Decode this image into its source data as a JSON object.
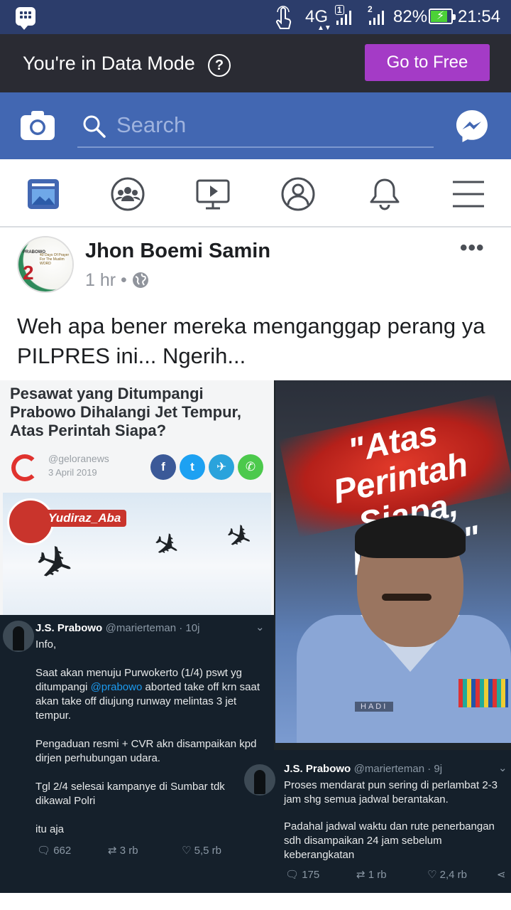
{
  "status_bar": {
    "network": "4G",
    "sim1": "1",
    "sim2": "2",
    "battery": "82%",
    "battery_level": 0.82,
    "time": "21:54"
  },
  "data_mode": {
    "message": "You're in Data Mode",
    "help_icon": "?",
    "button_label": "Go to Free",
    "button_color": "#a43bc6"
  },
  "header": {
    "search_placeholder": "Search",
    "brand_color": "#4267b2"
  },
  "nav": {
    "items": [
      "news-feed-icon",
      "groups-icon",
      "watch-icon",
      "profile-icon",
      "notifications-icon",
      "menu-icon"
    ]
  },
  "post": {
    "author": "Jhon Boemi Samin",
    "time": "1 hr",
    "separator": "•",
    "privacy_icon": "globe-icon",
    "more_label": "•••",
    "caption": "Weh apa bener mereka menganggap perang ya PILPRES ini... Ngerih...",
    "avatar_text": {
      "line1": "PRABOWO",
      "line2": "40 Days Of Prayer For The Muslim WORD",
      "number": "2"
    }
  },
  "image": {
    "article": {
      "headline": "Pesawat yang Ditumpangi Prabowo Dihalangi Jet Tempur, Atas Perintah Siapa?",
      "source": "@geloranews",
      "date": "3 April 2019",
      "share_icons": [
        "f",
        "t",
        "✈",
        "✆"
      ]
    },
    "watermark": "Yudiraz_Aba",
    "quote": "\"Atas Perintah Siapa, Pak..!!!\"",
    "name_tag": "HADI",
    "tweet1": {
      "name": "J.S. Prabowo",
      "handle": "@marierteman · 10j",
      "line_info": "Info,",
      "line1_pre": "Saat akan menuju Purwokerto (1/4) pswt yg ditumpangi ",
      "mention": "@prabowo",
      "line1_post": " aborted take off krn saat akan take off diujung runway melintas 3 jet tempur.",
      "line2": "Pengaduan resmi + CVR akn disampaikan kpd dirjen perhubungan udara.",
      "line3": "Tgl 2/4 selesai kampanye di Sumbar tdk dikawal Polri",
      "line4": "itu aja",
      "replies": "662",
      "retweets": "3 rb",
      "likes": "5,5 rb"
    },
    "tweet2": {
      "name": "J.S. Prabowo",
      "handle": "@marierteman · 9j",
      "line1": "Proses mendarat pun sering di perlambat 2-3 jam shg semua jadwal berantakan.",
      "line2": "Padahal jadwal waktu dan rute penerbangan sdh disampaikan 24 jam sebelum keberangkatan",
      "replies": "175",
      "retweets": "1 rb",
      "likes": "2,4 rb"
    }
  }
}
